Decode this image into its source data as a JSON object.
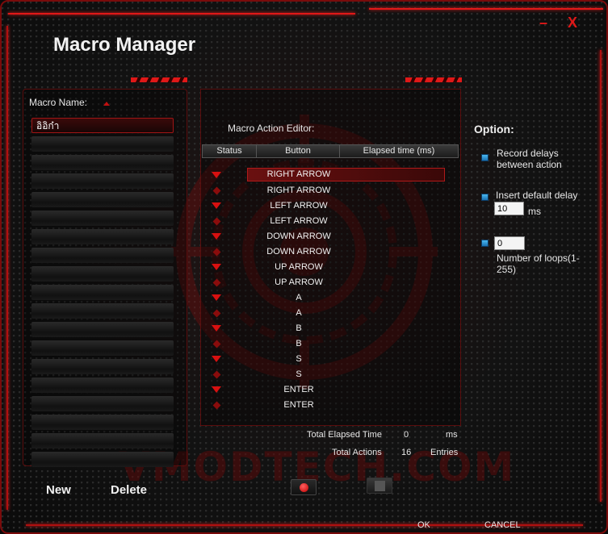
{
  "window": {
    "title": "Macro Manager",
    "minimize_label": "–",
    "close_label": "X"
  },
  "macro_panel": {
    "label": "Macro Name:",
    "items": [
      "อิอิก๋า",
      "",
      "",
      "",
      "",
      "",
      "",
      "",
      "",
      "",
      "",
      "",
      "",
      "",
      "",
      "",
      "",
      "",
      ""
    ]
  },
  "editor": {
    "label": "Macro Action Editor:",
    "columns": {
      "status": "Status",
      "button": "Button",
      "elapsed": "Elapsed time (ms)"
    },
    "actions": [
      {
        "button": "RIGHT ARROW",
        "status": "down"
      },
      {
        "button": "RIGHT ARROW",
        "status": "up"
      },
      {
        "button": "LEFT ARROW",
        "status": "down"
      },
      {
        "button": "LEFT ARROW",
        "status": "up"
      },
      {
        "button": "DOWN ARROW",
        "status": "down"
      },
      {
        "button": "DOWN ARROW",
        "status": "up"
      },
      {
        "button": "UP ARROW",
        "status": "down"
      },
      {
        "button": "UP ARROW",
        "status": "up"
      },
      {
        "button": "A",
        "status": "down"
      },
      {
        "button": "A",
        "status": "up"
      },
      {
        "button": "B",
        "status": "down"
      },
      {
        "button": "B",
        "status": "up"
      },
      {
        "button": "S",
        "status": "down"
      },
      {
        "button": "S",
        "status": "up"
      },
      {
        "button": "ENTER",
        "status": "down"
      },
      {
        "button": "ENTER",
        "status": "up"
      }
    ],
    "selected_index": 0,
    "total_elapsed_label": "Total Elapsed Time",
    "total_elapsed_value": "0",
    "total_elapsed_unit": "ms",
    "total_actions_label": "Total Actions",
    "total_actions_value": "16",
    "total_actions_unit": "Entries"
  },
  "options": {
    "title": "Option:",
    "record_delays": "Record delays\nbetween action",
    "insert_default_delay": "Insert default delay",
    "default_delay_value": "10",
    "default_delay_unit": "ms",
    "loops_value": "0",
    "loops_label": "Number of loops(1-\n255)"
  },
  "buttons": {
    "new": "New",
    "delete": "Delete",
    "ok": "OK",
    "cancel": "CANCEL"
  },
  "watermark": "VMODTECH.COM",
  "colors": {
    "accent": "#e01818",
    "checkbox": "#2a90d0",
    "background": "#121212"
  }
}
